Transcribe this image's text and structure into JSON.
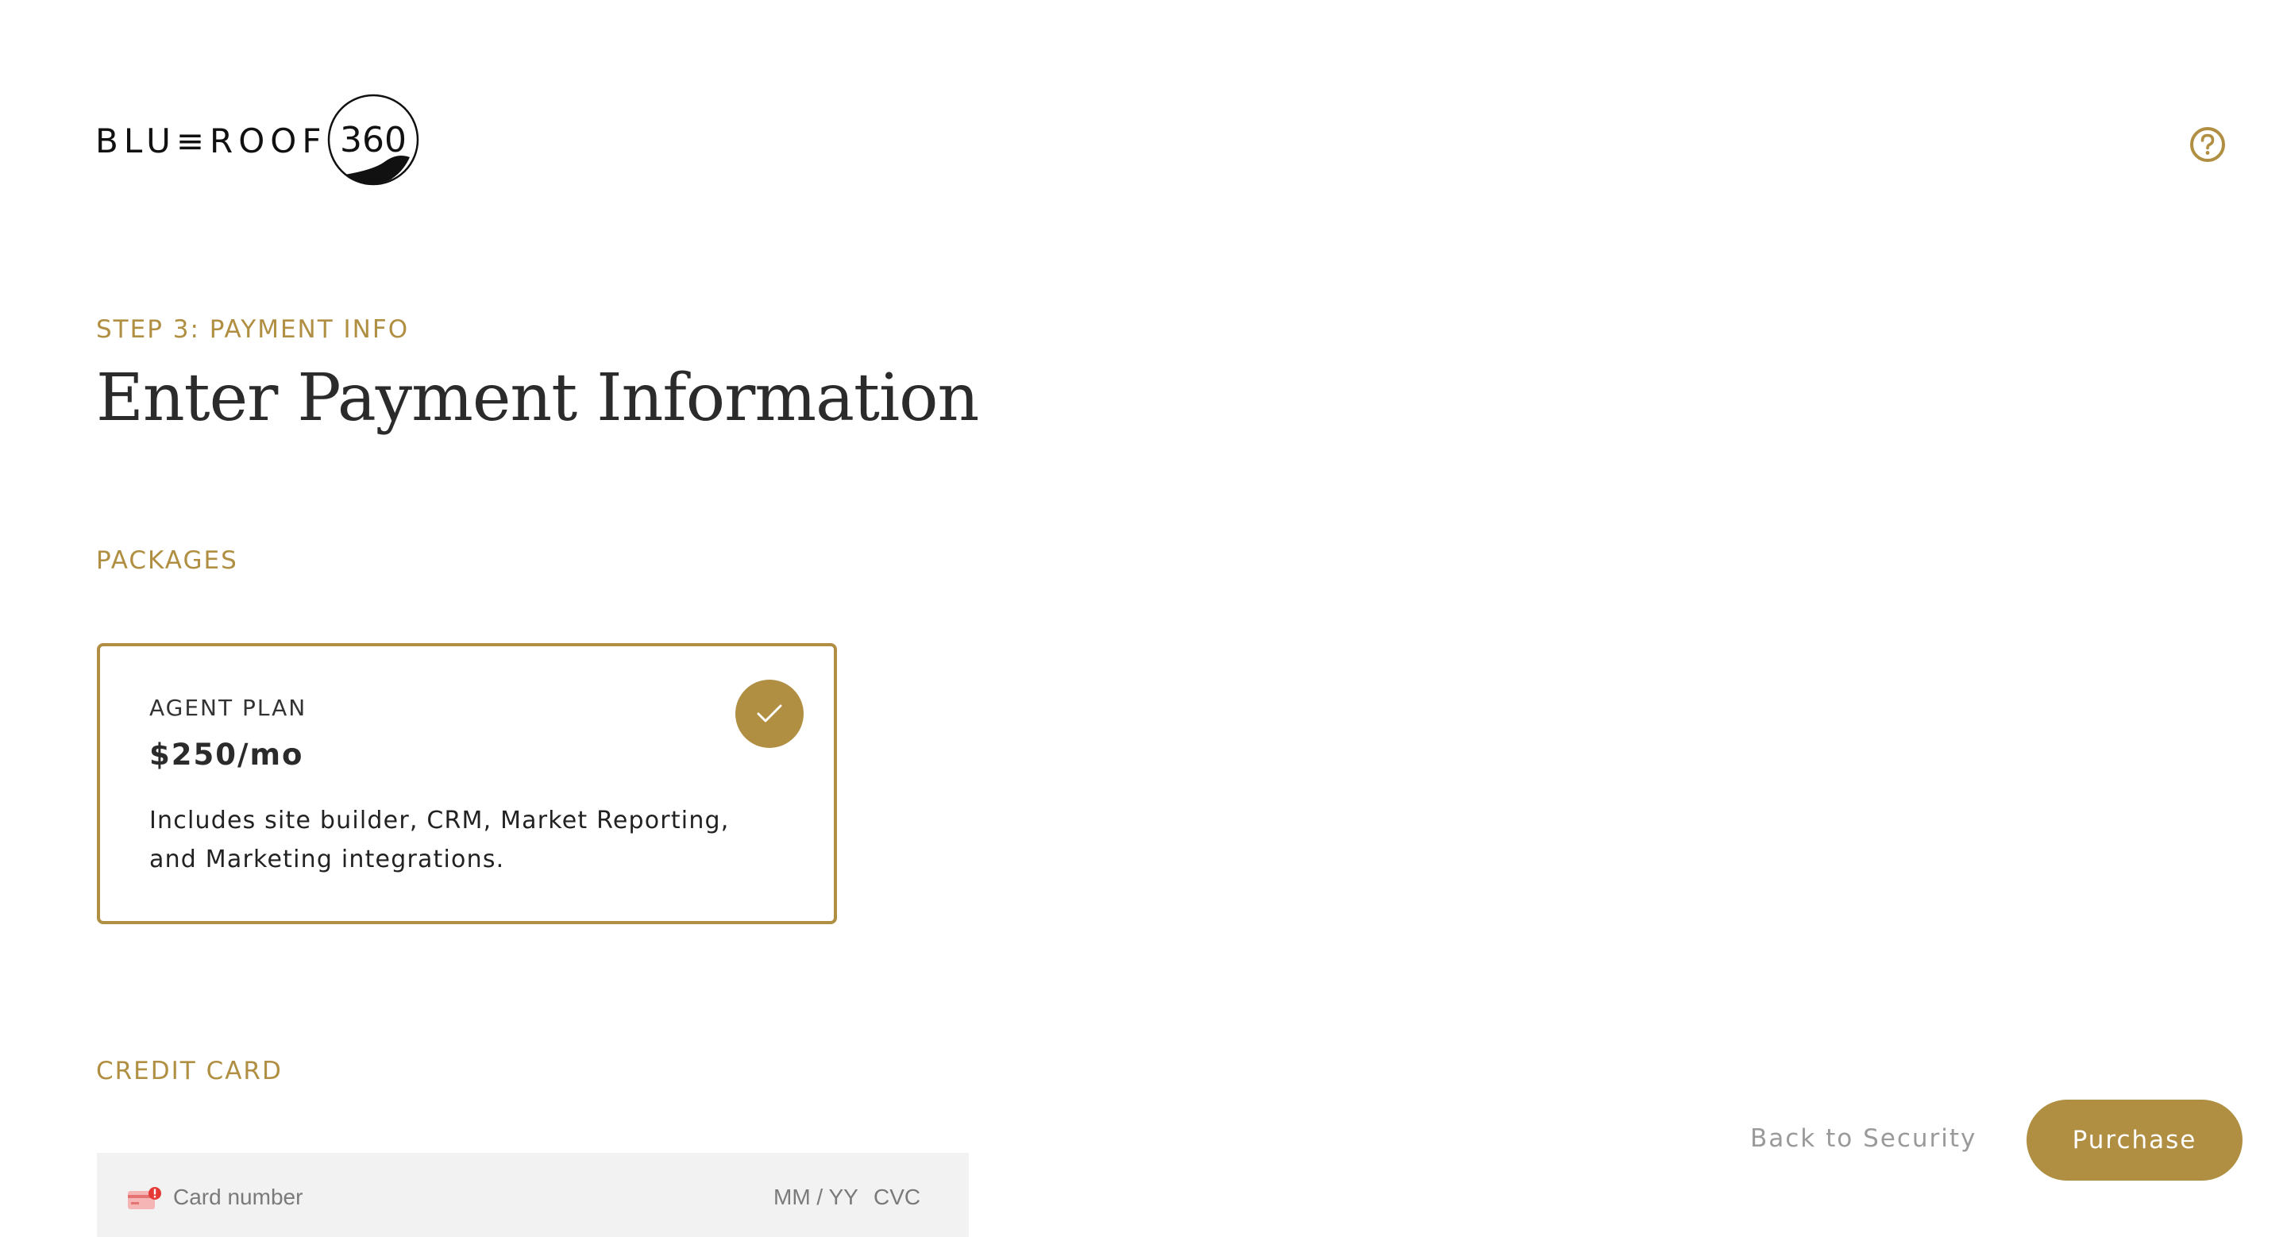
{
  "brand": {
    "wordmark": "BLU≡ROOF",
    "number": "360"
  },
  "header": {
    "help_icon": "question-circle-icon"
  },
  "step": {
    "label": "STEP 3: PAYMENT INFO",
    "title": "Enter Payment Information"
  },
  "packages": {
    "heading": "PACKAGES",
    "plan": {
      "name": "AGENT PLAN",
      "price": "$250/mo",
      "description": "Includes site builder, CRM, Market Reporting, and Marketing integrations.",
      "selected": true
    }
  },
  "credit_card": {
    "heading": "CREDIT CARD",
    "number_placeholder": "Card number",
    "expiry_placeholder": "MM / YY",
    "cvc_placeholder": "CVC",
    "card_icon": "credit-card-error-icon"
  },
  "actions": {
    "back_label": "Back to Security",
    "purchase_label": "Purchase"
  },
  "colors": {
    "accent": "#b08f42",
    "text": "#2b2b2b",
    "muted": "#9a9a9a",
    "field_bg": "#f2f2f2",
    "error": "#e53935"
  }
}
